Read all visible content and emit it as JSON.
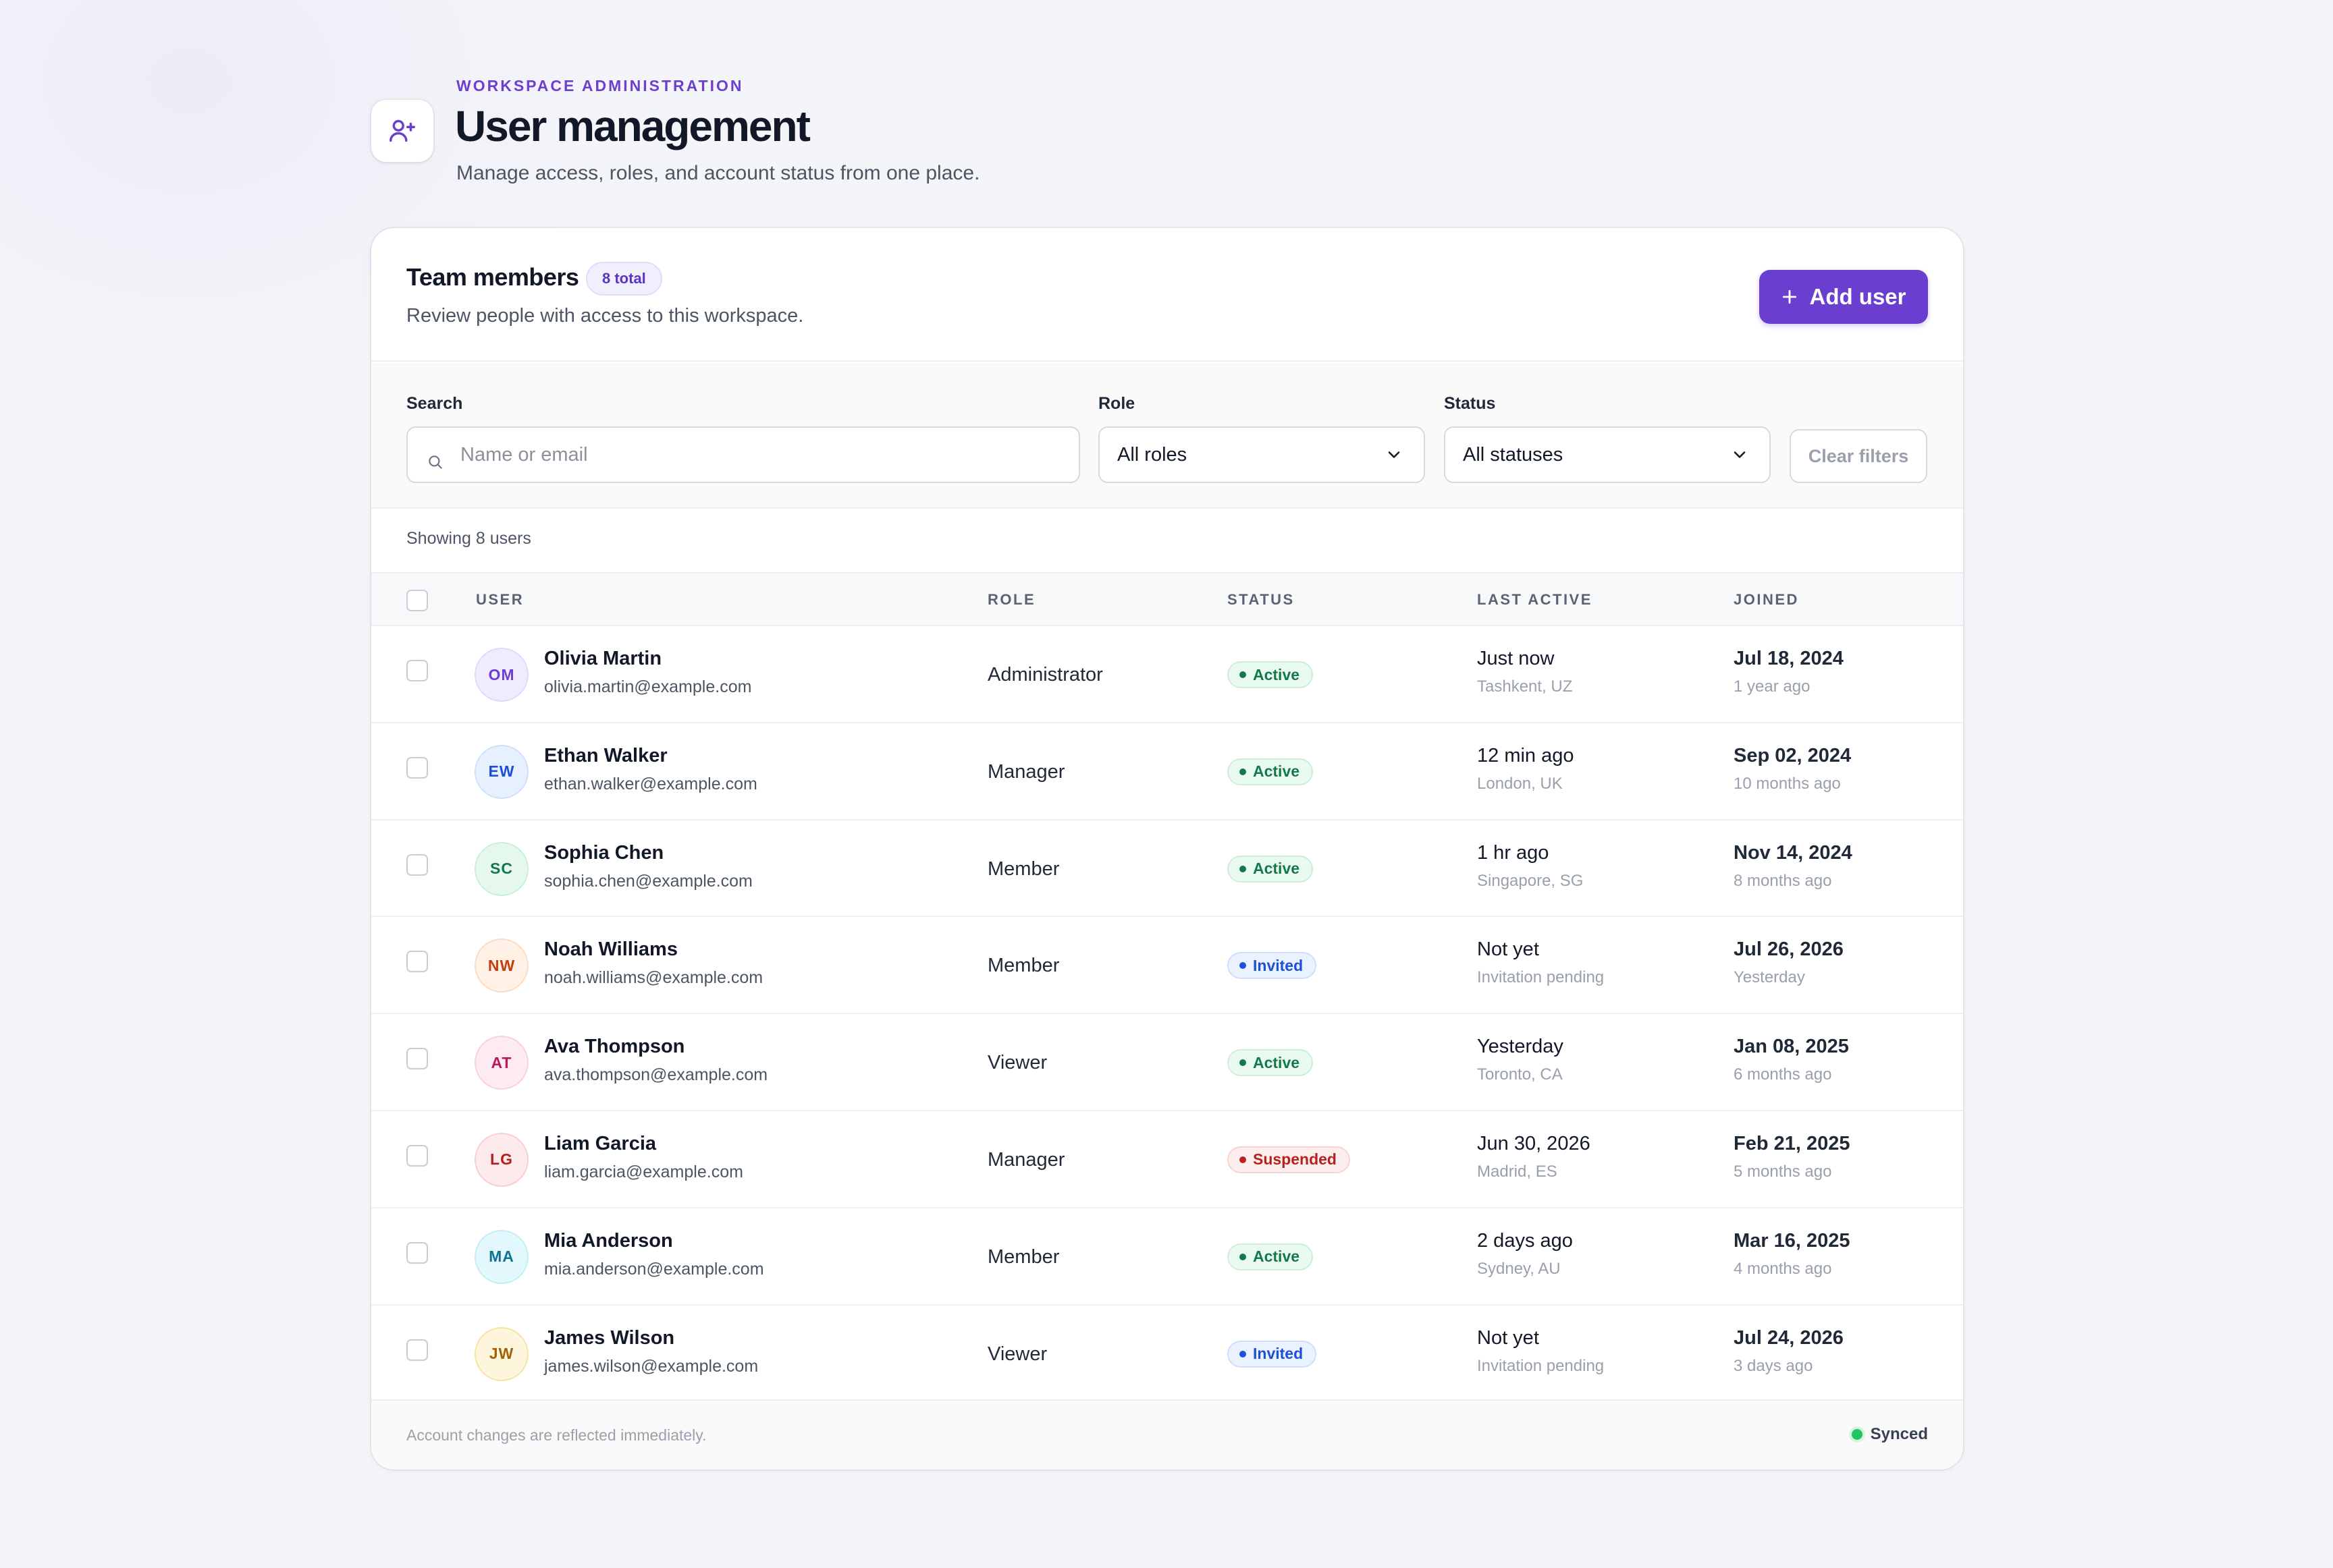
{
  "header": {
    "eyebrow": "WORKSPACE ADMINISTRATION",
    "title": "User management",
    "subtitle": "Manage access, roles, and account status from one place.",
    "icon": "user-plus-icon"
  },
  "card": {
    "title": "Team members",
    "count_badge": "8 total",
    "description": "Review people with access to this workspace.",
    "add_button": "Add user"
  },
  "filters": {
    "search_label": "Search",
    "search_placeholder": "Name or email",
    "search_value": "",
    "role_label": "Role",
    "role_value": "All roles",
    "status_label": "Status",
    "status_value": "All statuses",
    "clear_button": "Clear filters"
  },
  "showing": "Showing 8 users",
  "table": {
    "columns": [
      "USER",
      "ROLE",
      "STATUS",
      "LAST ACTIVE",
      "JOINED"
    ],
    "rows": [
      {
        "initials": "OM",
        "name": "Olivia Martin",
        "email": "olivia.martin@example.com",
        "role": "Administrator",
        "status": "Active",
        "last_active": "Just now",
        "location": "Tashkent, UZ",
        "joined": "Jul 18, 2024",
        "joined_ago": "1 year ago"
      },
      {
        "initials": "EW",
        "name": "Ethan Walker",
        "email": "ethan.walker@example.com",
        "role": "Manager",
        "status": "Active",
        "last_active": "12 min ago",
        "location": "London, UK",
        "joined": "Sep 02, 2024",
        "joined_ago": "10 months ago"
      },
      {
        "initials": "SC",
        "name": "Sophia Chen",
        "email": "sophia.chen@example.com",
        "role": "Member",
        "status": "Active",
        "last_active": "1 hr ago",
        "location": "Singapore, SG",
        "joined": "Nov 14, 2024",
        "joined_ago": "8 months ago"
      },
      {
        "initials": "NW",
        "name": "Noah Williams",
        "email": "noah.williams@example.com",
        "role": "Member",
        "status": "Invited",
        "last_active": "Not yet",
        "location": "Invitation pending",
        "joined": "Jul 26, 2026",
        "joined_ago": "Yesterday"
      },
      {
        "initials": "AT",
        "name": "Ava Thompson",
        "email": "ava.thompson@example.com",
        "role": "Viewer",
        "status": "Active",
        "last_active": "Yesterday",
        "location": "Toronto, CA",
        "joined": "Jan 08, 2025",
        "joined_ago": "6 months ago"
      },
      {
        "initials": "LG",
        "name": "Liam Garcia",
        "email": "liam.garcia@example.com",
        "role": "Manager",
        "status": "Suspended",
        "last_active": "Jun 30, 2026",
        "location": "Madrid, ES",
        "joined": "Feb 21, 2025",
        "joined_ago": "5 months ago"
      },
      {
        "initials": "MA",
        "name": "Mia Anderson",
        "email": "mia.anderson@example.com",
        "role": "Member",
        "status": "Active",
        "last_active": "2 days ago",
        "location": "Sydney, AU",
        "joined": "Mar 16, 2025",
        "joined_ago": "4 months ago"
      },
      {
        "initials": "JW",
        "name": "James Wilson",
        "email": "james.wilson@example.com",
        "role": "Viewer",
        "status": "Invited",
        "last_active": "Not yet",
        "location": "Invitation pending",
        "joined": "Jul 24, 2026",
        "joined_ago": "3 days ago"
      }
    ]
  },
  "avatar_colors": [
    {
      "bg": "#f1ecfd",
      "fg": "#6d3fd1",
      "ring": "#e2d8fb"
    },
    {
      "bg": "#e6f0ff",
      "fg": "#1d4fd7",
      "ring": "#cfe0fb"
    },
    {
      "bg": "#e6f8ed",
      "fg": "#12794a",
      "ring": "#c9efd8"
    },
    {
      "bg": "#fff1e6",
      "fg": "#c2410c",
      "ring": "#fbdcc4"
    },
    {
      "bg": "#fdeaf3",
      "fg": "#be185d",
      "ring": "#f8d1e3"
    },
    {
      "bg": "#fdeaea",
      "fg": "#b91c1c",
      "ring": "#f8cfcf"
    },
    {
      "bg": "#e3f8fc",
      "fg": "#0e7490",
      "ring": "#c4eef6"
    },
    {
      "bg": "#fef6dc",
      "fg": "#a16207",
      "ring": "#f6e3a5"
    }
  ],
  "footer": {
    "note": "Account changes are reflected immediately.",
    "sync_status": "Synced"
  },
  "colors": {
    "accent": "#6a3fd0",
    "active": "#12794a",
    "invited": "#1d4fd7",
    "suspended": "#b4231f"
  }
}
